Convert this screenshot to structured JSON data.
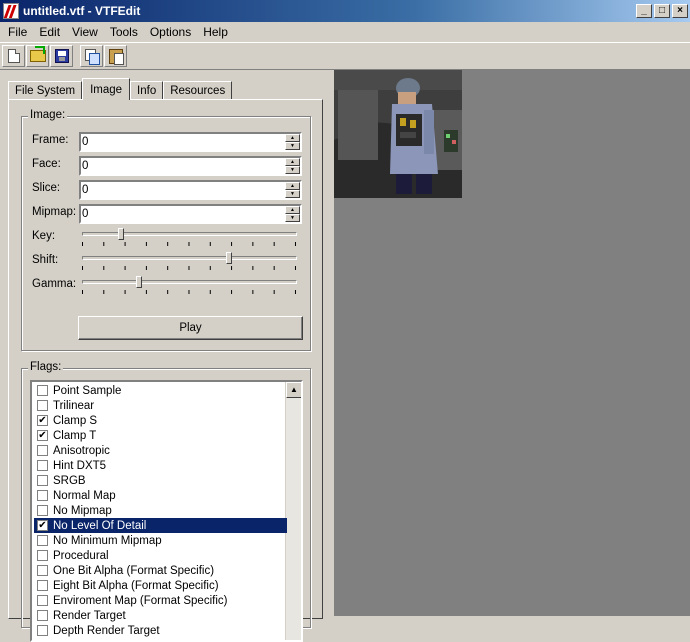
{
  "window": {
    "title": "untitled.vtf - VTFEdit",
    "minimize": "_",
    "maximize": "□",
    "close": "×"
  },
  "menu": [
    "File",
    "Edit",
    "View",
    "Tools",
    "Options",
    "Help"
  ],
  "toolbar": {
    "icons": [
      "new-file-icon",
      "open-folder-icon",
      "save-icon",
      "copy-icon",
      "paste-icon"
    ]
  },
  "tabs": [
    {
      "label": "File System",
      "active": false
    },
    {
      "label": "Image",
      "active": true
    },
    {
      "label": "Info",
      "active": false
    },
    {
      "label": "Resources",
      "active": false
    }
  ],
  "image_group": {
    "label": "Image:",
    "frame_label": "Frame:",
    "frame_value": "0",
    "face_label": "Face:",
    "face_value": "0",
    "slice_label": "Slice:",
    "slice_value": "0",
    "mipmap_label": "Mipmap:",
    "mipmap_value": "0",
    "key_label": "Key:",
    "key_level": 0.17,
    "shift_label": "Shift:",
    "shift_level": 0.69,
    "gamma_label": "Gamma:",
    "gamma_level": 0.26,
    "play_label": "Play"
  },
  "flags_group": {
    "label": "Flags:",
    "items": [
      {
        "label": "Point Sample",
        "checked": false,
        "selected": false
      },
      {
        "label": "Trilinear",
        "checked": false,
        "selected": false
      },
      {
        "label": "Clamp S",
        "checked": true,
        "selected": false
      },
      {
        "label": "Clamp T",
        "checked": true,
        "selected": false
      },
      {
        "label": "Anisotropic",
        "checked": false,
        "selected": false
      },
      {
        "label": "Hint DXT5",
        "checked": false,
        "selected": false
      },
      {
        "label": "SRGB",
        "checked": false,
        "selected": false
      },
      {
        "label": "Normal Map",
        "checked": false,
        "selected": false
      },
      {
        "label": "No Mipmap",
        "checked": false,
        "selected": false
      },
      {
        "label": "No Level Of Detail",
        "checked": true,
        "selected": true
      },
      {
        "label": "No Minimum Mipmap",
        "checked": false,
        "selected": false
      },
      {
        "label": "Procedural",
        "checked": false,
        "selected": false
      },
      {
        "label": "One Bit Alpha (Format Specific)",
        "checked": false,
        "selected": false
      },
      {
        "label": "Eight Bit Alpha (Format Specific)",
        "checked": false,
        "selected": false
      },
      {
        "label": "Enviroment Map (Format Specific)",
        "checked": false,
        "selected": false
      },
      {
        "label": "Render Target",
        "checked": false,
        "selected": false
      },
      {
        "label": "Depth Render Target",
        "checked": false,
        "selected": false
      }
    ]
  },
  "colors": {
    "selection": "#0a246a",
    "preview_background": "#808080"
  }
}
